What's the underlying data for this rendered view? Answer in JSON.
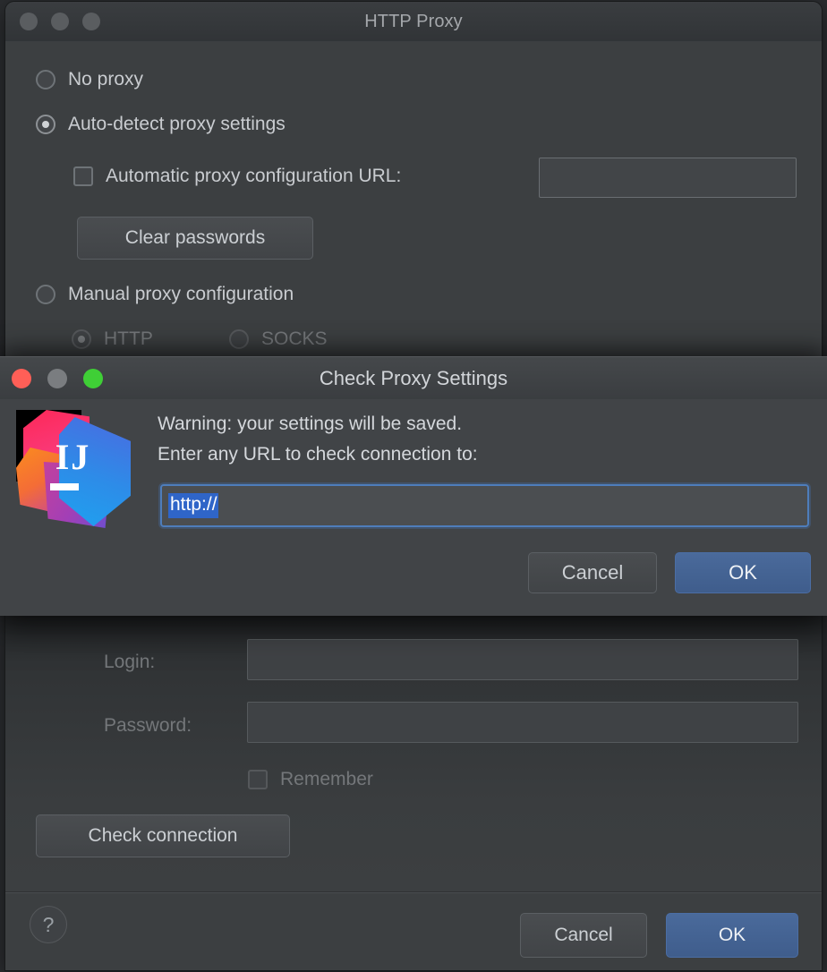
{
  "background_window": {
    "title": "HTTP Proxy",
    "traffic_lights": {
      "close": "close-button",
      "minimize": "minimize-button",
      "zoom": "zoom-button"
    },
    "options": {
      "no_proxy": "No proxy",
      "auto_detect": "Auto-detect proxy settings",
      "auto_config_url": "Automatic proxy configuration URL:",
      "auto_config_url_value": "",
      "clear_passwords": "Clear passwords",
      "manual": "Manual proxy configuration",
      "http": "HTTP",
      "socks": "SOCKS"
    },
    "auth": {
      "login_label": "Login:",
      "login_value": "",
      "password_label": "Password:",
      "password_value": "",
      "remember": "Remember",
      "check_connection": "Check connection"
    },
    "footer": {
      "help": "?",
      "cancel": "Cancel",
      "ok": "OK"
    },
    "selected_radio": "auto_detect"
  },
  "dialog": {
    "title": "Check Proxy Settings",
    "message_line_1": "Warning: your settings will be saved.",
    "message_line_2": "Enter any URL to check connection to:",
    "url_input": {
      "value": "http://",
      "selected": true
    },
    "logo": {
      "letters": "IJ",
      "name": "intellij-idea-logo"
    },
    "buttons": {
      "cancel": "Cancel",
      "ok": "OK"
    }
  },
  "colors": {
    "window_bg": "#3c3f41",
    "dialog_bg": "#414447",
    "accent_primary": "#3f5d8c",
    "focus_ring": "#4e7dbb",
    "selection_blue": "#2f65c8",
    "text": "#c9ccd0",
    "text_dim": "#74777a",
    "traffic_close": "#ff5f57",
    "traffic_min": "#7a7d80",
    "traffic_zoom": "#3fcf36"
  }
}
